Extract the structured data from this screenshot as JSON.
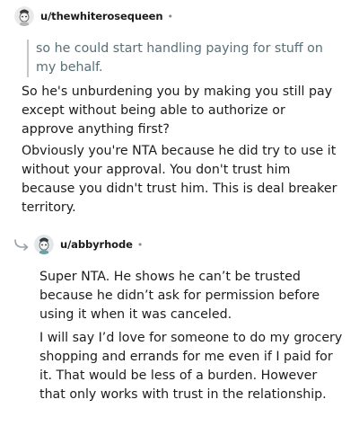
{
  "comments": [
    {
      "username": "u/thewhiterosequeen",
      "separator": "•",
      "quote": "so he could start handling paying for stuff on my behalf.",
      "paragraphs": [
        "So he's unburdening you by making you still pay except without being able to authorize or approve anything first?",
        "Obviously you're NTA because he did try to use it without your approval. You don't trust him because you didn't trust him. This is deal breaker territory."
      ]
    },
    {
      "username": "u/abbyrhode",
      "separator": "•",
      "paragraphs": [
        "Super NTA. He shows he can’t be trusted because he didn’t ask for permission before using it when it was canceled.",
        "I will say I’d love for someone to do my grocery shopping and errands for me even if I paid for it. That would be less of a burden. However that only works with trust in the relationship."
      ]
    }
  ],
  "icons": {
    "avatar": "snoo-avatar-icon",
    "reply": "reply-arrow-icon"
  },
  "colors": {
    "text": "#1c1c1c",
    "quote_text": "#576f76",
    "quote_bar": "#c4c6c8",
    "meta": "#878a8c"
  }
}
